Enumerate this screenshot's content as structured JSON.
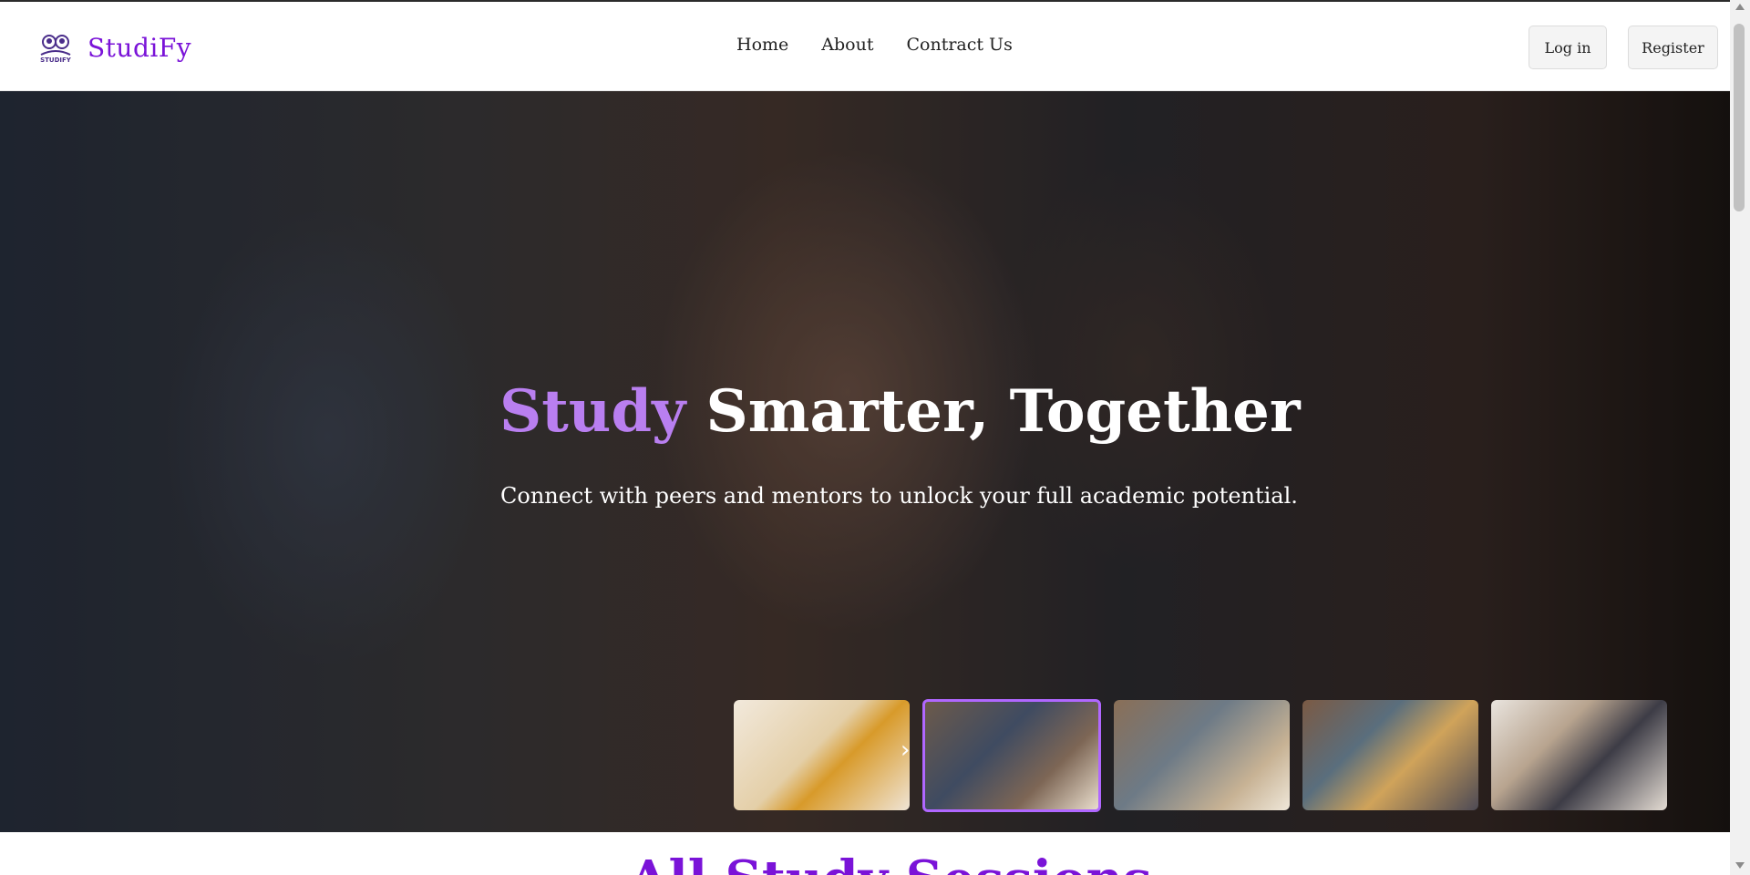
{
  "brand": {
    "name": "StudiFy",
    "logo_icon": "studify-logo-icon",
    "logo_text": "STUDIFY",
    "color": "#7a13d8"
  },
  "nav": {
    "items": [
      {
        "label": "Home"
      },
      {
        "label": "About"
      },
      {
        "label": "Contract Us"
      }
    ]
  },
  "auth": {
    "login_label": "Log in",
    "register_label": "Register"
  },
  "hero": {
    "title_accent": "Study",
    "title_rest": " Smarter, Together",
    "subtitle": "Connect with peers and mentors to unlock your full academic potential.",
    "accent_color": "#b97ff0",
    "thumbnails": [
      {
        "icon": "study-photo-1"
      },
      {
        "icon": "study-photo-2",
        "active": true
      },
      {
        "icon": "study-photo-3"
      },
      {
        "icon": "study-photo-4"
      },
      {
        "icon": "study-photo-5"
      }
    ]
  },
  "section": {
    "title": "All Study Sessions"
  }
}
